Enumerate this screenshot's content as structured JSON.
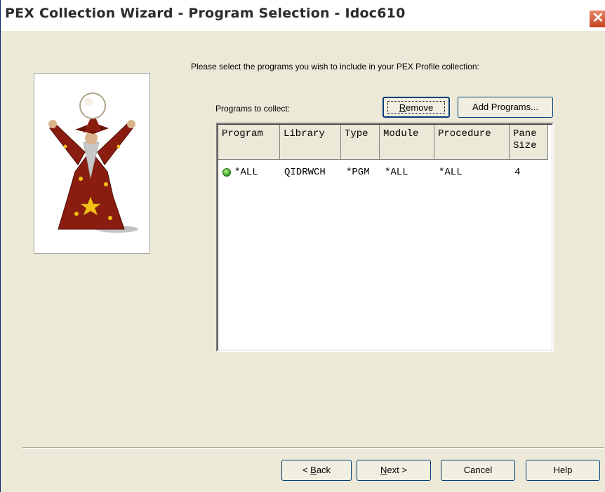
{
  "window": {
    "title": "PEX Collection Wizard - Program Selection - Idoc610",
    "close_glyph": "✕"
  },
  "wizard_image": {
    "icon": "wizard-illustration"
  },
  "instructions": "Please select the programs you wish to include in your PEX Profile collection:",
  "programs_label": "Programs to collect:",
  "buttons": {
    "remove": {
      "accesskey": "R",
      "rest": "emove"
    },
    "add_programs": "Add Programs...",
    "back": {
      "prefix": "< ",
      "accesskey": "B",
      "rest": "ack"
    },
    "next": {
      "accesskey": "N",
      "rest": "ext >"
    },
    "cancel": "Cancel",
    "help": "Help"
  },
  "table": {
    "columns": [
      "Program",
      "Library",
      "Type",
      "Module",
      "Procedure",
      "Pane Size"
    ],
    "rows": [
      {
        "status_icon": "green-status-icon",
        "program": "*ALL",
        "library": "QIDRWCH",
        "type": "*PGM",
        "module": "*ALL",
        "procedure": "*ALL",
        "pane_size": "4"
      }
    ]
  },
  "colors": {
    "dialog_bg": "#ece9d8",
    "button_border": "#003c74",
    "close_button": "#c5431d",
    "status_green": "#2f9a1a"
  }
}
